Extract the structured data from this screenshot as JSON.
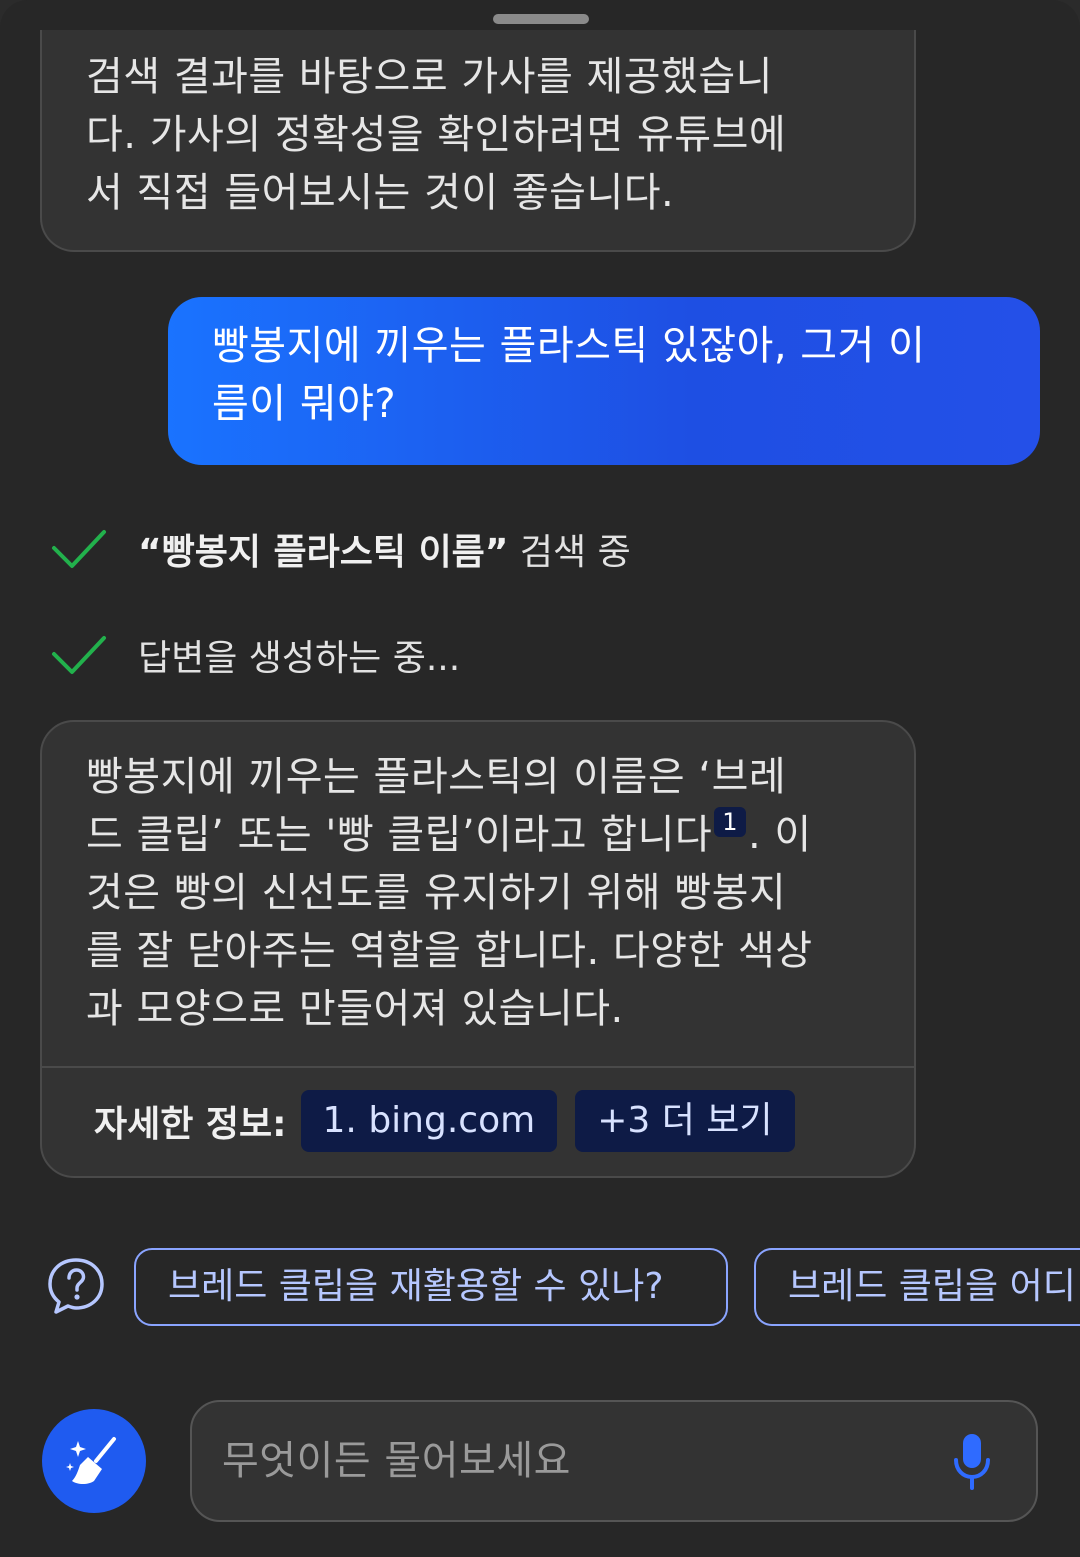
{
  "previous_answer": {
    "lines": [
      "검색 결과를 바탕으로 가사를 제공했습니",
      "다. 가사의 정확성을 확인하려면 유튜브에",
      "서 직접 들어보시는 것이 좋습니다."
    ]
  },
  "user_message": {
    "lines": [
      "빵봉지에 끼우는 플라스틱 있잖아, 그거 이",
      "름이 뭐야?"
    ]
  },
  "status": {
    "search_query": "“빵봉지 플라스틱 이름”",
    "search_suffix": " 검색 중",
    "generating": "답변을 생성하는 중..."
  },
  "answer": {
    "line1": "빵봉지에 끼우는 플라스틱의 이름은 ‘브레",
    "line2_a": "드 클립’ 또는 '빵 클립’이라고 합니다",
    "citation": "1",
    "line2_b": ". 이",
    "line3": "것은 빵의 신선도를 유지하기 위해 빵봉지",
    "line4": "를 잘 닫아주는 역할을 합니다. 다양한 색상",
    "line5": "과 모양으로 만들어져 있습니다.",
    "sources_label": "자세한 정보:",
    "source_1": "1. bing.com",
    "more_sources": "+3 더 보기"
  },
  "suggestions": [
    "브레드 클립을 재활용할 수 있나?",
    "브레드 클립을 어디"
  ],
  "input": {
    "placeholder": "무엇이든 물어보세요"
  },
  "colors": {
    "accent": "#1e5af0",
    "check": "#22b14c",
    "chip_bg": "#0e1b46",
    "suggest_border": "#8aa4ff"
  },
  "icons": [
    "check-icon",
    "question-bubble-icon",
    "broom-sparkle-icon",
    "microphone-icon"
  ]
}
